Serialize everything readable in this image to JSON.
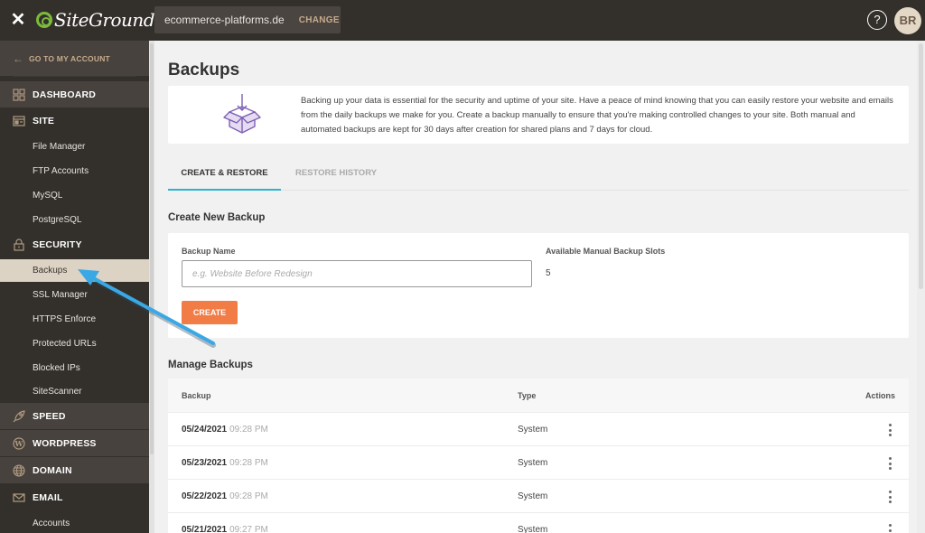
{
  "topbar": {
    "close_label": "✕",
    "logo_text": "SiteGround",
    "site_name": "ecommerce-platforms.de",
    "change_label": "CHANGE",
    "help_label": "?",
    "avatar_initials": "BR"
  },
  "sidebar": {
    "go_account": "GO TO MY ACCOUNT",
    "sections": [
      {
        "label": "DASHBOARD",
        "icon": "grid-icon"
      },
      {
        "label": "SITE",
        "icon": "browser-icon",
        "items": [
          "File Manager",
          "FTP Accounts",
          "MySQL",
          "PostgreSQL"
        ]
      },
      {
        "label": "SECURITY",
        "icon": "lock-icon",
        "items": [
          "Backups",
          "SSL Manager",
          "HTTPS Enforce",
          "Protected URLs",
          "Blocked IPs",
          "SiteScanner"
        ]
      },
      {
        "label": "SPEED",
        "icon": "rocket-icon"
      },
      {
        "label": "WORDPRESS",
        "icon": "wordpress-icon"
      },
      {
        "label": "DOMAIN",
        "icon": "globe-icon"
      },
      {
        "label": "EMAIL",
        "icon": "envelope-icon",
        "items": [
          "Accounts"
        ]
      }
    ],
    "active_item": "Backups"
  },
  "main": {
    "title": "Backups",
    "info_text": "Backing up your data is essential for the security and uptime of your site. Have a peace of mind knowing that you can easily restore your website and emails from the daily backups we make for you. Create a backup manually to ensure that you're making controlled changes to your site. Both manual and automated backups are kept for 30 days after creation for shared plans and 7 days for cloud.",
    "tabs": [
      {
        "label": "CREATE & RESTORE",
        "active": true
      },
      {
        "label": "RESTORE HISTORY",
        "active": false
      }
    ],
    "create": {
      "section_title": "Create New Backup",
      "name_label": "Backup Name",
      "name_placeholder": "e.g. Website Before Redesign",
      "name_value": "",
      "slots_label": "Available Manual Backup Slots",
      "slots_value": "5",
      "button_label": "CREATE"
    },
    "manage": {
      "section_title": "Manage Backups",
      "columns": [
        "Backup",
        "Type",
        "Actions"
      ],
      "rows": [
        {
          "date": "05/24/2021",
          "time": "09:28 PM",
          "type": "System"
        },
        {
          "date": "05/23/2021",
          "time": "09:28 PM",
          "type": "System"
        },
        {
          "date": "05/22/2021",
          "time": "09:28 PM",
          "type": "System"
        },
        {
          "date": "05/21/2021",
          "time": "09:27 PM",
          "type": "System"
        }
      ]
    }
  },
  "colors": {
    "accent_button": "#f27c45",
    "tab_underline": "#2bb3d2",
    "sidebar_bg": "#33302c",
    "active_item_bg": "#ddd3c4",
    "annotation_arrow": "#3aa8e4"
  }
}
